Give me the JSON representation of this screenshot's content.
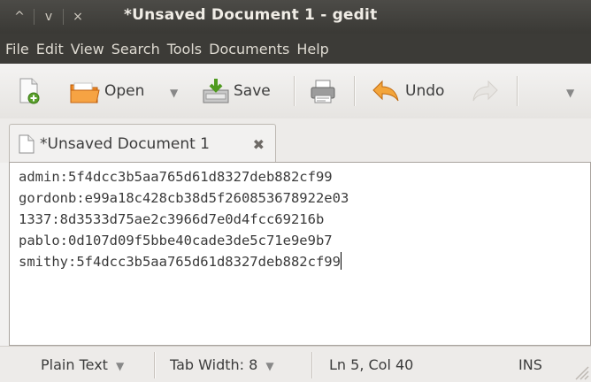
{
  "window": {
    "title": "*Unsaved Document 1 - gedit",
    "controls": {
      "minimize": "^",
      "maximize": "v",
      "close": "×"
    }
  },
  "menubar": {
    "items": [
      "File",
      "Edit",
      "View",
      "Search",
      "Tools",
      "Documents",
      "Help"
    ]
  },
  "toolbar": {
    "open_label": "Open",
    "save_label": "Save",
    "undo_label": "Undo",
    "dropdown_glyph": "▼",
    "icons": [
      "new-document-icon",
      "open-folder-icon",
      "save-icon",
      "print-icon",
      "undo-icon",
      "redo-icon"
    ]
  },
  "tab": {
    "label": "*Unsaved Document 1"
  },
  "editor": {
    "lines": [
      "admin:5f4dcc3b5aa765d61d8327deb882cf99",
      "gordonb:e99a18c428cb38d5f260853678922e03",
      "1337:8d3533d75ae2c3966d7e0d4fcc69216b",
      "pablo:0d107d09f5bbe40cade3de5c71e9e9b7",
      "smithy:5f4dcc3b5aa765d61d8327deb882cf99"
    ]
  },
  "statusbar": {
    "language": "Plain Text",
    "tab_width": "Tab Width: 8",
    "position": "Ln 5, Col 40",
    "mode": "INS",
    "dropdown_glyph": "▼"
  },
  "colors": {
    "titlebar": "#3c3b37",
    "menubar": "#3c3b37",
    "toolbar": "#f0efed",
    "editor_bg": "#ffffff"
  }
}
